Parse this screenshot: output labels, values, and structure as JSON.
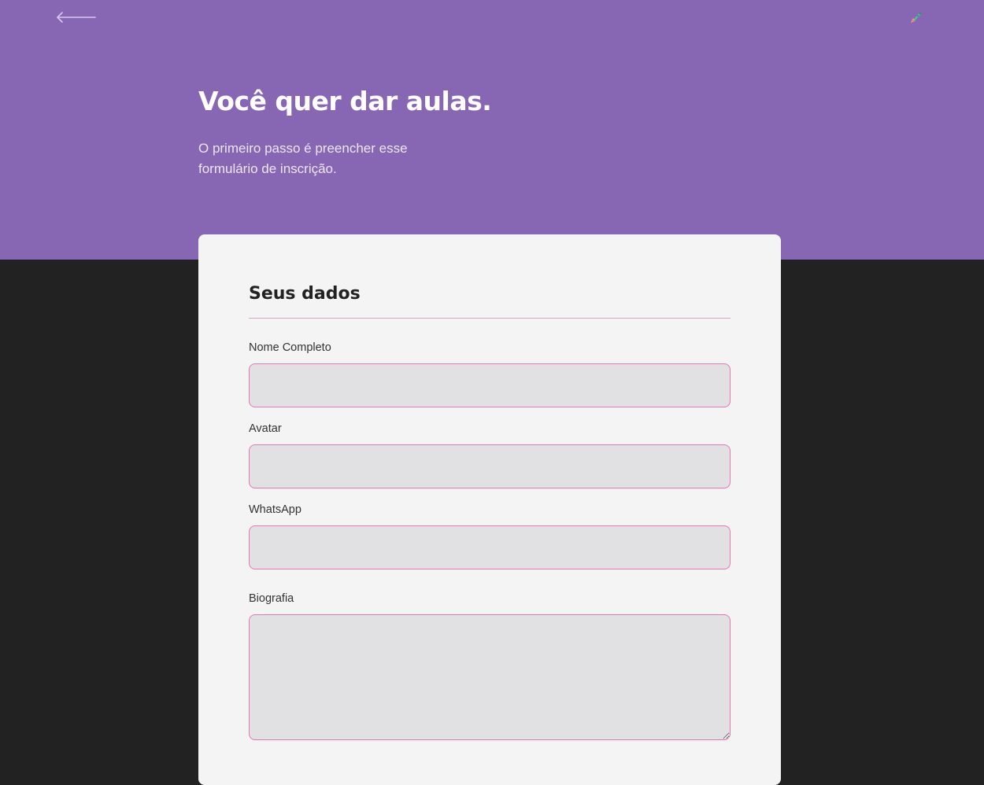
{
  "header": {
    "back_icon": "arrow-left-icon",
    "logo_icon": "rocket-icon",
    "title": "Você quer dar aulas.",
    "description": "O primeiro passo é preencher esse formulário de inscrição.",
    "background_color": "#8767b4"
  },
  "form": {
    "section_title": "Seus dados",
    "fields": [
      {
        "label": "Nome Completo",
        "value": "",
        "type": "text"
      },
      {
        "label": "Avatar",
        "value": "",
        "type": "text"
      },
      {
        "label": "WhatsApp",
        "value": "",
        "type": "text"
      },
      {
        "label": "Biografia",
        "value": "",
        "type": "textarea"
      }
    ],
    "accent_color": "#e676b6"
  }
}
